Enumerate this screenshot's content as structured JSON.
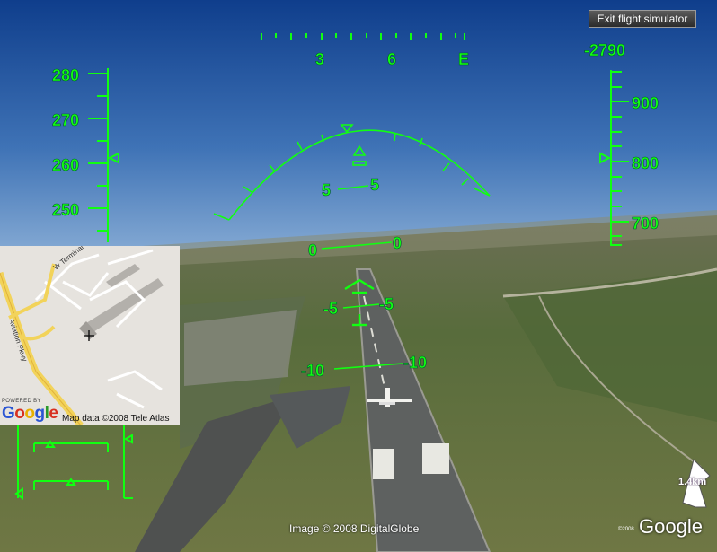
{
  "window": {
    "exit_button": "Exit flight simulator"
  },
  "hud": {
    "color": "#11ff11",
    "heading_labels": [
      "3",
      "6",
      "E"
    ],
    "vertical_speed": "-2790",
    "airspeed_labels": [
      "280",
      "270",
      "260",
      "250"
    ],
    "altitude_labels": [
      "900",
      "800",
      "700"
    ],
    "pitch_ladder": [
      {
        "left": "5",
        "right": "5"
      },
      {
        "left": "0",
        "right": "0"
      },
      {
        "left": "-5",
        "right": "-5"
      },
      {
        "left": "-10",
        "right": "-10"
      }
    ]
  },
  "minimap": {
    "road_labels": [
      "W Terminal",
      "Aviation Pkwy"
    ],
    "powered_by": "POWERED BY",
    "logo": "Google",
    "map_data": "Map data ©2008 Tele Atlas"
  },
  "scene": {
    "imagery_credit": "Image © 2008 DigitalGlobe",
    "logo": "Google",
    "logo_copyright": "©2008",
    "scale_label": "1.4km"
  }
}
